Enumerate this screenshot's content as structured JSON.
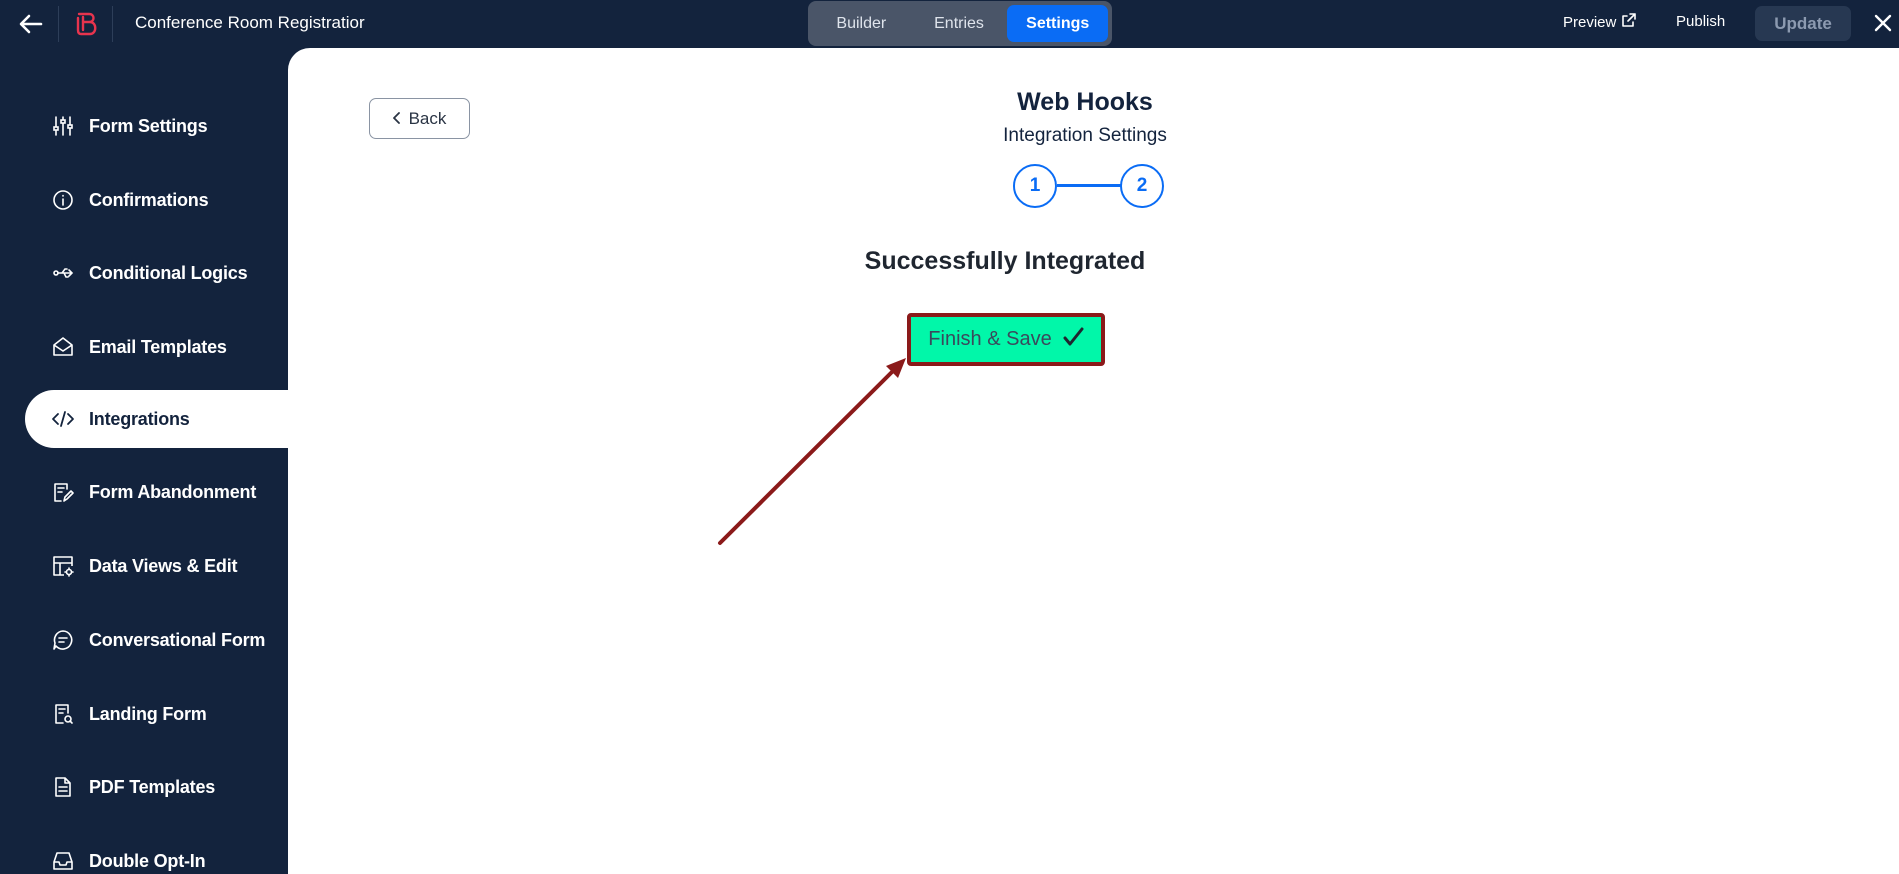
{
  "topbar": {
    "title": "Conference Room Registratior",
    "tabs": [
      {
        "label": "Builder"
      },
      {
        "label": "Entries"
      },
      {
        "label": "Settings"
      }
    ],
    "preview_label": "Preview",
    "publish_label": "Publish",
    "update_label": "Update"
  },
  "sidebar": {
    "items": [
      {
        "label": "Form Settings",
        "icon": "sliders-icon"
      },
      {
        "label": "Confirmations",
        "icon": "info-icon"
      },
      {
        "label": "Conditional Logics",
        "icon": "usb-icon"
      },
      {
        "label": "Email Templates",
        "icon": "envelope-icon"
      },
      {
        "label": "Integrations",
        "icon": "code-icon"
      },
      {
        "label": "Form Abandonment",
        "icon": "form-edit-icon"
      },
      {
        "label": "Data Views & Edit",
        "icon": "table-gear-icon"
      },
      {
        "label": "Conversational Form",
        "icon": "chat-icon"
      },
      {
        "label": "Landing Form",
        "icon": "landing-page-icon"
      },
      {
        "label": "PDF Templates",
        "icon": "pdf-icon"
      },
      {
        "label": "Double Opt-In",
        "icon": "inbox-icon"
      }
    ]
  },
  "main": {
    "back_label": "Back",
    "title": "Web Hooks",
    "subtitle": "Integration Settings",
    "steps": [
      "1",
      "2"
    ],
    "status": "Successfully Integrated",
    "finish_label": "Finish & Save"
  },
  "colors": {
    "sidebar_bg": "#13233d",
    "accent_blue": "#0a6cf5",
    "finish_green": "#01f7a9",
    "annotation_red": "#8b1a1a"
  }
}
